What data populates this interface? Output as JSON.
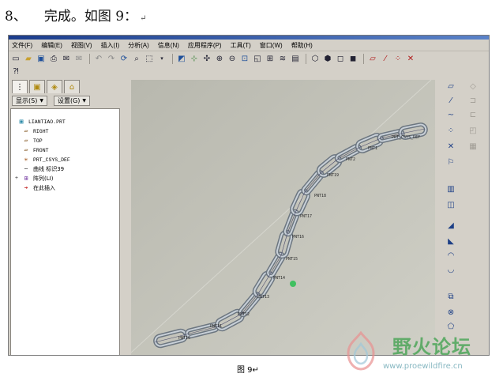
{
  "heading": {
    "number": "8、",
    "text": "完成。如图 9：",
    "mark": "↵"
  },
  "menu": [
    "文件(F)",
    "编辑(E)",
    "视图(V)",
    "插入(I)",
    "分析(A)",
    "信息(N)",
    "应用程序(P)",
    "工具(T)",
    "窗口(W)",
    "帮助(H)"
  ],
  "panel": {
    "show_button": "显示(S)",
    "settings_button": "设置(G)",
    "tree": [
      {
        "icon": "part-icon",
        "label": "LIANTIAO.PRT",
        "indent": 0
      },
      {
        "icon": "datum-plane-icon",
        "label": "RIGHT",
        "indent": 1
      },
      {
        "icon": "datum-plane-icon",
        "label": "TOP",
        "indent": 1
      },
      {
        "icon": "datum-plane-icon",
        "label": "FRONT",
        "indent": 1
      },
      {
        "icon": "csys-icon",
        "label": "PRT_CSYS_DEF",
        "indent": 1
      },
      {
        "icon": "curve-icon",
        "label": "曲线 标识39",
        "indent": 1
      },
      {
        "icon": "pattern-icon",
        "label": "阵列(LI)",
        "indent": 1,
        "expand": "+"
      },
      {
        "icon": "insert-here-icon",
        "label": "在此插入",
        "indent": 1
      }
    ]
  },
  "viewport": {
    "point_labels": [
      "PNT10",
      "PNT11",
      "PNT12",
      "PNT13",
      "PNT14",
      "PNT15",
      "PNT16",
      "PNT17",
      "PNT18",
      "PNT19",
      "PNT2",
      "PNT1",
      "PRT_CSYS_DEF"
    ]
  },
  "watermark": {
    "title": "野火论坛",
    "url": "www.proewildfire.cn"
  },
  "caption": "图 9↵"
}
